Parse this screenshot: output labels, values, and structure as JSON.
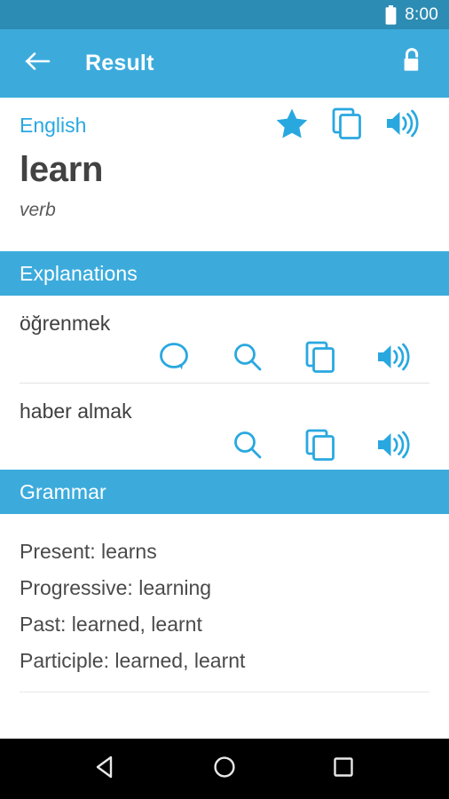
{
  "status_bar": {
    "time": "8:00",
    "battery_icon": "battery-full-icon",
    "background_color": "#2d8cb4"
  },
  "app_bar": {
    "back_icon": "arrow-left-icon",
    "title": "Result",
    "lock_icon": "lock-open-icon",
    "background_color": "#3cabdc"
  },
  "word": {
    "language": "English",
    "term": "learn",
    "part_of_speech": "verb",
    "accent_color": "#29a8e0",
    "actions": [
      {
        "name": "favorite-star-icon",
        "label": "Favorite"
      },
      {
        "name": "copy-icon",
        "label": "Copy"
      },
      {
        "name": "speaker-icon",
        "label": "Pronounce"
      }
    ]
  },
  "sections": [
    {
      "title": "Explanations",
      "items": [
        {
          "text": "öğrenmek",
          "actions": [
            "comment-icon",
            "search-icon",
            "copy-icon",
            "speaker-icon"
          ]
        },
        {
          "text": "haber almak",
          "actions": [
            "search-icon",
            "copy-icon",
            "speaker-icon"
          ]
        }
      ]
    },
    {
      "title": "Grammar",
      "lines": [
        "Present: learns",
        "Progressive: learning",
        "Past: learned, learnt",
        "Participle: learned, learnt"
      ]
    }
  ],
  "nav_bar": {
    "back_icon": "nav-back-triangle-icon",
    "home_icon": "nav-home-circle-icon",
    "recents_icon": "nav-recents-square-icon",
    "background_color": "#000000"
  }
}
